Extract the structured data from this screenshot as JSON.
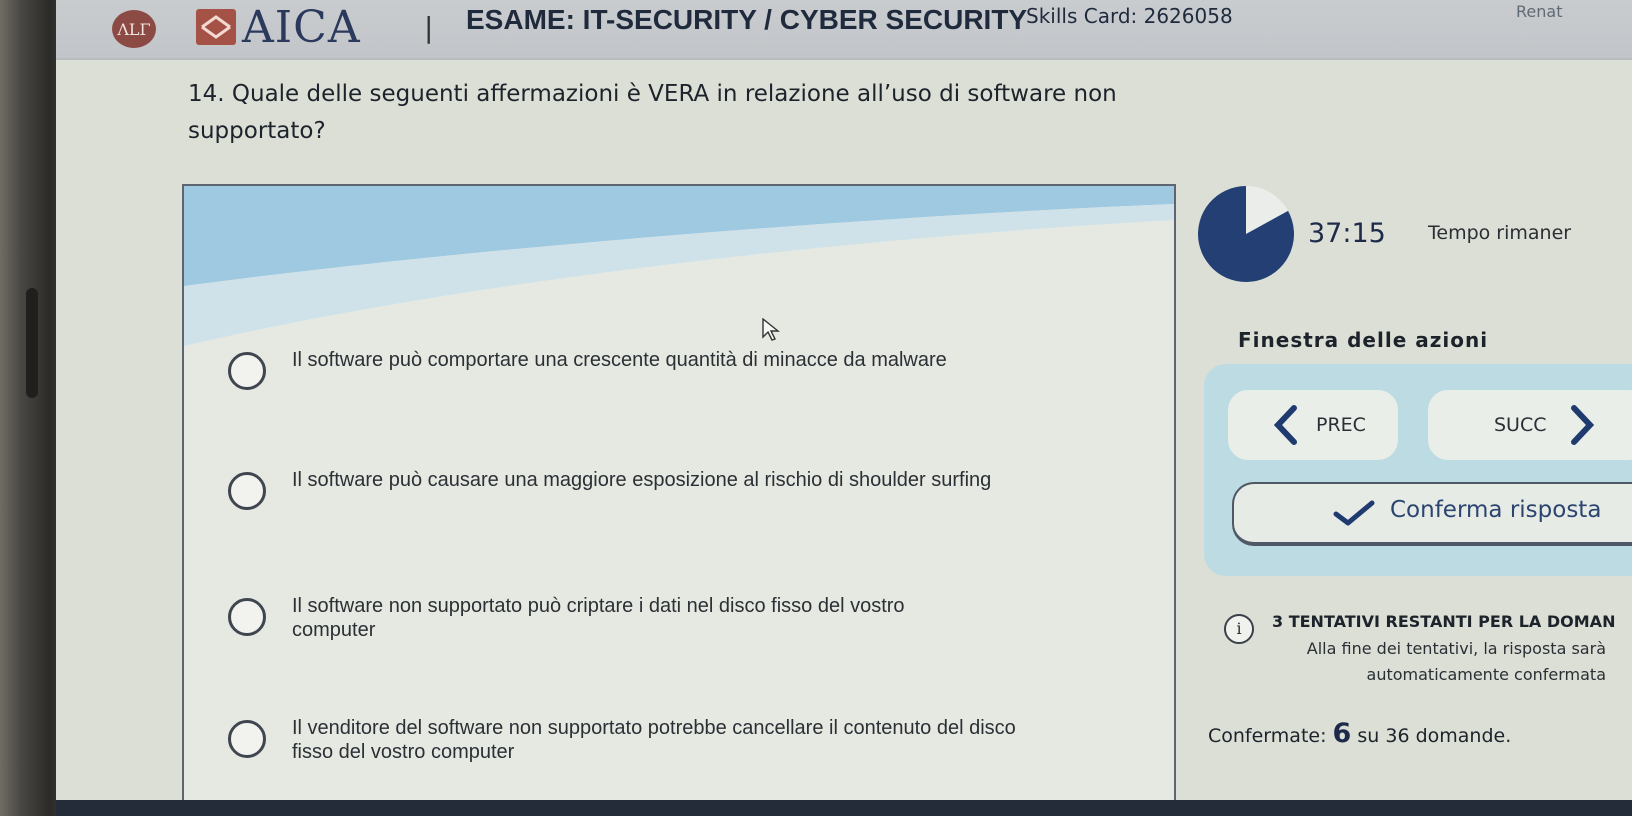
{
  "header": {
    "logo_circle_text": "ΛLΓ",
    "brand": "AICA",
    "separator": "|",
    "exam_title": "ESAME: IT-SECURITY / CYBER SECURITY",
    "skills_card": "Skills Card: 2626058",
    "user_name": "Renat"
  },
  "question": {
    "number": "14.",
    "text": "Quale delle seguenti affermazioni è VERA in relazione all’uso di software non supportato?"
  },
  "answers": [
    {
      "text": "Il software può comportare una crescente quantità di minacce da malware"
    },
    {
      "text": "Il software può causare una maggiore esposizione al rischio di shoulder surfing"
    },
    {
      "text": "Il software non supportato può criptare i dati nel disco fisso del vostro computer"
    },
    {
      "text": "Il venditore del software non supportato potrebbe cancellare il contenuto del disco fisso del vostro computer"
    }
  ],
  "timer": {
    "value": "37:15",
    "label": "Tempo rimaner",
    "remaining_fraction": 0.83
  },
  "actions": {
    "title": "Finestra delle azioni",
    "prev_label": "PREC",
    "next_label": "SUCC",
    "confirm_label": "Conferma risposta"
  },
  "info": {
    "icon_glyph": "i",
    "attempts": "3 TENTATIVI RESTANTI PER LA DOMAN",
    "note": "Alla fine dei tentativi, la risposta sarà automaticamente confermata"
  },
  "progress": {
    "prefix": "Confermate:",
    "confirmed": "6",
    "suffix": "su 36 domande."
  },
  "colors": {
    "accent_navy": "#1f3a6e",
    "action_box": "#bcdbe3",
    "header_bg": "#c6c9cd"
  }
}
